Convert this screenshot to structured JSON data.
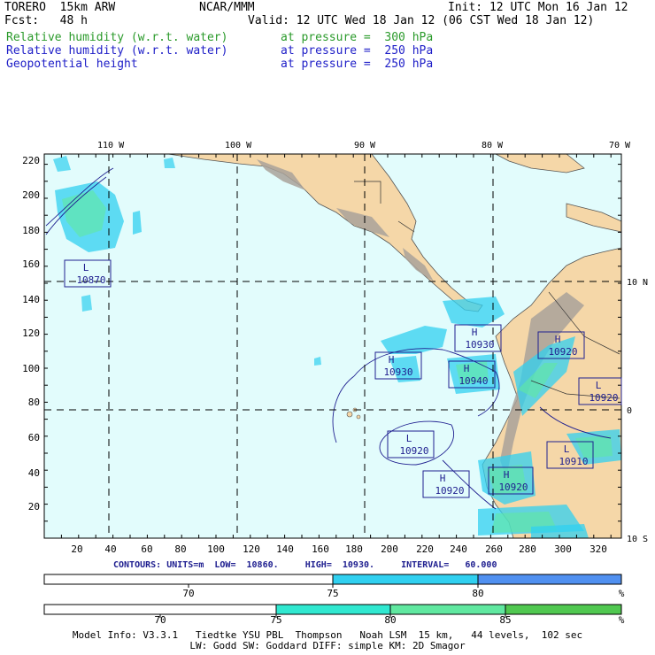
{
  "header": {
    "model": "TORERO  15km ARW",
    "center": "NCAR/MMM",
    "init": "Init: 12 UTC Mon 16 Jan 12",
    "fcst": "Fcst:   48 h",
    "valid": "Valid: 12 UTC Wed 18 Jan 12 (06 CST Wed 18 Jan 12)",
    "fields": [
      {
        "name": "Relative humidity (w.r.t. water)",
        "level": "at pressure =  300 hPa",
        "color": "#2a9a2a"
      },
      {
        "name": "Relative humidity (w.r.t. water)",
        "level": "at pressure =  250 hPa",
        "color": "#2020c8"
      },
      {
        "name": "Geopotential height",
        "level": "at pressure =  250 hPa",
        "color": "#2020c8"
      }
    ]
  },
  "map": {
    "lon_labels": [
      "110 W",
      "100 W",
      "90 W",
      "80 W",
      "70 W"
    ],
    "lat_labels": [
      "10 N",
      "0",
      "10 S"
    ],
    "x_ticks": [
      "20",
      "40",
      "60",
      "80",
      "100",
      "120",
      "140",
      "160",
      "180",
      "200",
      "220",
      "240",
      "260",
      "280",
      "300",
      "320"
    ],
    "y_ticks": [
      "20",
      "40",
      "60",
      "80",
      "100",
      "120",
      "140",
      "160",
      "180",
      "200",
      "220"
    ],
    "centers": [
      {
        "type": "L",
        "value": "10870"
      },
      {
        "type": "H",
        "value": "10930"
      },
      {
        "type": "H",
        "value": "10930"
      },
      {
        "type": "H",
        "value": "10940"
      },
      {
        "type": "H",
        "value": "10920"
      },
      {
        "type": "L",
        "value": "10920"
      },
      {
        "type": "L",
        "value": "10920"
      },
      {
        "type": "L",
        "value": "10910"
      },
      {
        "type": "H",
        "value": "10920"
      },
      {
        "type": "H",
        "value": "10920"
      }
    ],
    "ocean_color": "#e2fcfc",
    "land_color": "#f5d7a8",
    "terrain_color": "#a9a29a",
    "contour_color": "#202090"
  },
  "contours_info": "CONTOURS: UNITS=m  LOW=  10860.     HIGH=  10930.     INTERVAL=   60.000",
  "colorbar1": {
    "labels": [
      "70",
      "75",
      "80"
    ],
    "unit": "%",
    "colors": [
      "#ffffff",
      "#30d0f0",
      "#5090f0"
    ]
  },
  "colorbar2": {
    "labels": [
      "70",
      "75",
      "80",
      "85"
    ],
    "unit": "%",
    "colors": [
      "#ffffff",
      "#30e8d0",
      "#60e8a0",
      "#50c850"
    ]
  },
  "footer": {
    "line1": "Model Info: V3.3.1   Tiedtke YSU PBL  Thompson   Noah LSM  15 km,   44 levels,  102 sec",
    "line2": "LW: Godd SW: Goddard DIFF: simple KM: 2D Smagor"
  }
}
